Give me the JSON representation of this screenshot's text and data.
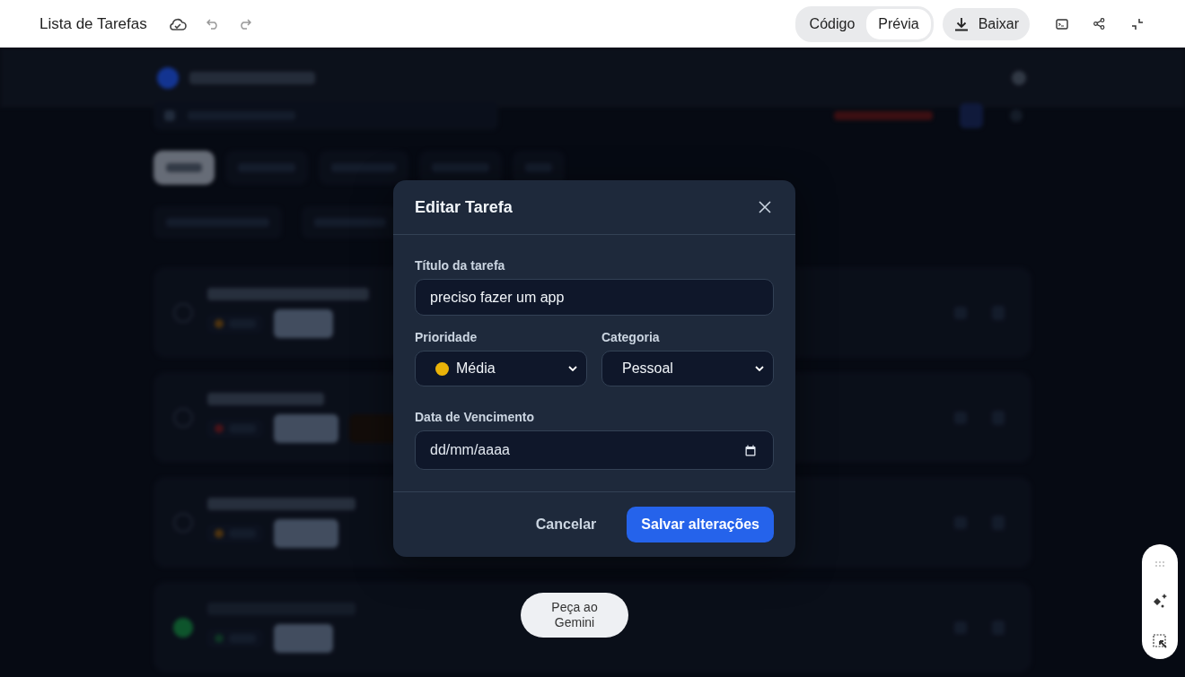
{
  "top_bar": {
    "title": "Lista de Tarefas",
    "view_tabs": [
      {
        "label": "Código",
        "selected": false
      },
      {
        "label": "Prévia",
        "selected": true
      }
    ],
    "download_button": "Baixar"
  },
  "dialog": {
    "title": "Editar Tarefa",
    "title_field": {
      "label": "Título da tarefa",
      "value": "preciso fazer um app"
    },
    "priority": {
      "label": "Prioridade",
      "value": "Média",
      "color": "#eab308"
    },
    "category": {
      "label": "Categoria",
      "value": "Pessoal"
    },
    "due_date": {
      "label": "Data de Vencimento",
      "placeholder": "dd/mm/aaaa"
    },
    "cancel_button": "Cancelar",
    "save_button": "Salvar alterações"
  },
  "gemini_button": "Peça ao Gemini"
}
